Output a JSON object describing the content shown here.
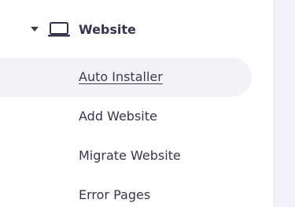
{
  "sidebar": {
    "section": {
      "label": "Website",
      "expanded": true,
      "icon": "laptop-icon",
      "caret_icon": "caret-down-icon"
    },
    "items": [
      {
        "label": "Auto Installer",
        "active": true
      },
      {
        "label": "Add Website",
        "active": false
      },
      {
        "label": "Migrate Website",
        "active": false
      },
      {
        "label": "Error Pages",
        "active": false
      }
    ]
  },
  "colors": {
    "text": "#36344d",
    "active_bg": "#f3f2f6",
    "main_bg": "#f4f3fd",
    "divider": "#e6e5ee"
  }
}
